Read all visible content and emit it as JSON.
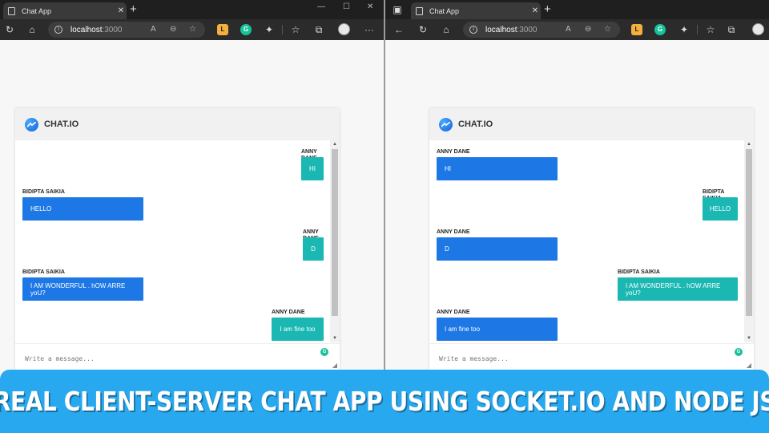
{
  "browser": {
    "tab_title": "Chat App",
    "new_tab": "+",
    "address_host": "localhost",
    "address_port": ":3000",
    "ext_l": "L",
    "ext_g": "G",
    "minimize": "—",
    "maximize": "☐",
    "close": "✕",
    "tab_close": "✕",
    "more": "···"
  },
  "app": {
    "brand": "CHAT.IO",
    "placeholder": "Write a message...",
    "grammarly": "G"
  },
  "left_chat": {
    "messages": [
      {
        "sender": "ANNY DANE",
        "text": "HI",
        "side": "right"
      },
      {
        "sender": "BIDIPTA SAIKIA",
        "text": "HELLO",
        "side": "left"
      },
      {
        "sender": "ANNY DANE",
        "text": "D",
        "side": "right"
      },
      {
        "sender": "BIDIPTA SAIKIA",
        "text": "I AM WONDERFUL . hOW ARRE yoU?",
        "side": "left"
      },
      {
        "sender": "ANNY DANE",
        "text": "I am fine too",
        "side": "right"
      }
    ]
  },
  "right_chat": {
    "messages": [
      {
        "sender": "ANNY DANE",
        "text": "HI",
        "side": "left"
      },
      {
        "sender": "BIDIPTA SAIKIA",
        "text": "HELLO",
        "side": "right"
      },
      {
        "sender": "ANNY DANE",
        "text": "D",
        "side": "left"
      },
      {
        "sender": "BIDIPTA SAIKIA",
        "text": "I AM WONDERFUL . hOW ARRE yoU?",
        "side": "right"
      },
      {
        "sender": "ANNY DANE",
        "text": "I am fine too",
        "side": "left"
      }
    ]
  },
  "banner": {
    "text": "REAL CLIENT-SERVER CHAT APP USING SOCKET.IO AND NODE JS"
  },
  "colors": {
    "own_bubble": "#1d78e5",
    "other_bubble": "#1ab7b3",
    "banner": "#27a8ef"
  }
}
